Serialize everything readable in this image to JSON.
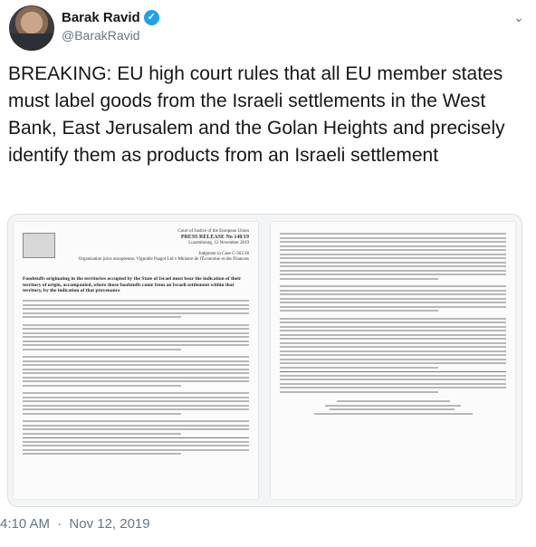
{
  "author": {
    "display_name": "Barak Ravid",
    "handle": "@BarakRavid",
    "verified_icon": "verified-badge-icon",
    "verified_color": "#1da1f2"
  },
  "tweet": {
    "text": "BREAKING: EU high court rules that all EU member states must label goods from the Israeli settlements in the West Bank, East Jerusalem and the Golan Heights and precisely identify them as products from an Israeli settlement",
    "time": "4:10 AM",
    "separator": "·",
    "date": "Nov 12, 2019"
  },
  "document": {
    "court": "Court of Justice of the European Union",
    "press_release": "PRESS RELEASE No 140/19",
    "location_date": "Luxembourg, 12 November 2019",
    "judgment": "Judgment in Case C-363/18",
    "parties": "Organisation juive européenne, Vignoble Psagot Ltd v Ministre de l'Économie et des Finances",
    "heading": "Foodstuffs originating in the territories occupied by the State of Israel must bear the indication of their territory of origin, accompanied, where those foodstuffs come from an Israeli settlement within that territory, by the indication of that provenance"
  },
  "colors": {
    "text_primary": "#14171a",
    "text_secondary": "#657786",
    "accent": "#1da1f2"
  }
}
